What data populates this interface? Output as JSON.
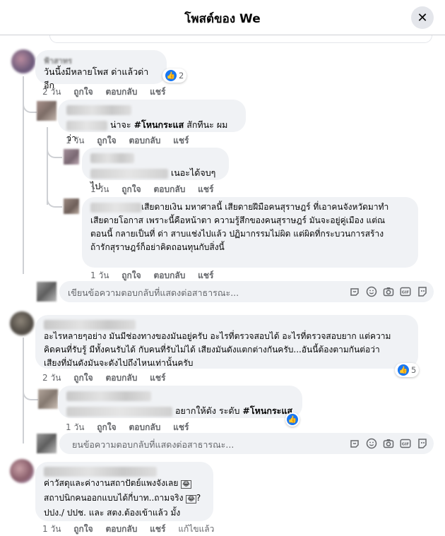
{
  "header": {
    "title": "โพสต์ของ We",
    "close_icon": "close-icon"
  },
  "comments": [
    {
      "text": "วันนี้งมีหลายโพส ด่าแล้วด่าอีก",
      "time": "2 วัน",
      "like": "ถูกใจ",
      "reply": "ตอบกลับ",
      "share": "แชร์",
      "reactions": "2",
      "replies": [
        {
          "text_prefix": "น่าจะ ",
          "hashtag": "#โหนกระแส",
          "text_suffix": " สักทีนะ ผมว่า",
          "time": "1 วัน",
          "like": "ถูกใจ",
          "reply": "ตอบกลับ",
          "share": "แชร์"
        },
        {
          "text": "เนอะได้จบๆไป",
          "time": "1 วัน",
          "like": "ถูกใจ",
          "reply": "ตอบกลับ",
          "share": "แชร์"
        },
        {
          "lines": [
            "เสียดายเงิน มหาศาลนี้ เสียดายฝีมือคนสุราษฎร์ ที่เอาคนจังหวัดมาทำ",
            "เสียดายโอกาส เพราะนี้คือหน้าตา ความรู้สึกของคนสุราษฎร์ มันจะอยู่คู่เมือง แต่ณ",
            "ตอนนี้ กลายเป็นที่ ด่า สาบแช่งไปแล้ว ปฏิมากรรมไม่ผิด แต่ผิดที่กระบวนการสร้าง",
            "ถ้ารักสุราษฎร์ก็อย่าคิดถอนทุนกับสิ่งนี้"
          ],
          "time": "1 วัน",
          "like": "ถูกใจ",
          "reply": "ตอบกลับ",
          "share": "แชร์"
        }
      ],
      "reply_placeholder": "เขียนข้อความตอบกลับที่แสดงต่อสาธารณะ..."
    },
    {
      "lines": [
        "อะไรหลายๆอย่าง มันมีช่องทางของมันอยู่ครับ อะไรที่ตรวจสอบได้ อะไรที่ตรวจสอบยาก แต่ความ",
        "คิดคนที่รับรู้ มีทั้งคนรับได้ กับคนที่รับไม่ได้ เสียงมันดังแตกต่างกันครับ...อันนี้ต้องตามกันต่อว่า",
        "เสียงที่มันดังมันจะดังไปถึงไหนเท่านั้นครับ"
      ],
      "time": "2 วัน",
      "like": "ถูกใจ",
      "reply": "ตอบกลับ",
      "share": "แชร์",
      "reactions": "5",
      "replies": [
        {
          "text_prefix": "อยากให้ดัง ระดับ ",
          "hashtag": "#โหนกระแส",
          "time": "1 วัน",
          "like": "ถูกใจ",
          "reply": "ตอบกลับ",
          "share": "แชร์"
        }
      ],
      "reply_placeholder": "ยนข้อความตอบกลับที่แสดงต่อสาธารณะ..."
    },
    {
      "lines": [
        "ค่าวัสดุและค่างานสถาปัตย์แพงจังเลย",
        "สถาปนิกคนออกแบบได้กี่บาท..ถามจริง",
        "ปปง./ ปปช. และ สตง.ต้องเข้าแล้ว มั้ง"
      ],
      "time": "1 วัน",
      "like": "ถูกใจ",
      "reply": "ตอบกลับ",
      "share": "แชร์",
      "edited": "แก้ไขแล้ว"
    }
  ],
  "partial_name": "ฟ้าสาทร",
  "reply_icons": [
    "sticker-icon",
    "emoji-icon",
    "camera-icon",
    "gif-icon",
    "avatar-sticker-icon"
  ],
  "colors": {
    "accent": "#1877f2",
    "bubble": "#f0f2f5",
    "meta": "#65676b"
  }
}
